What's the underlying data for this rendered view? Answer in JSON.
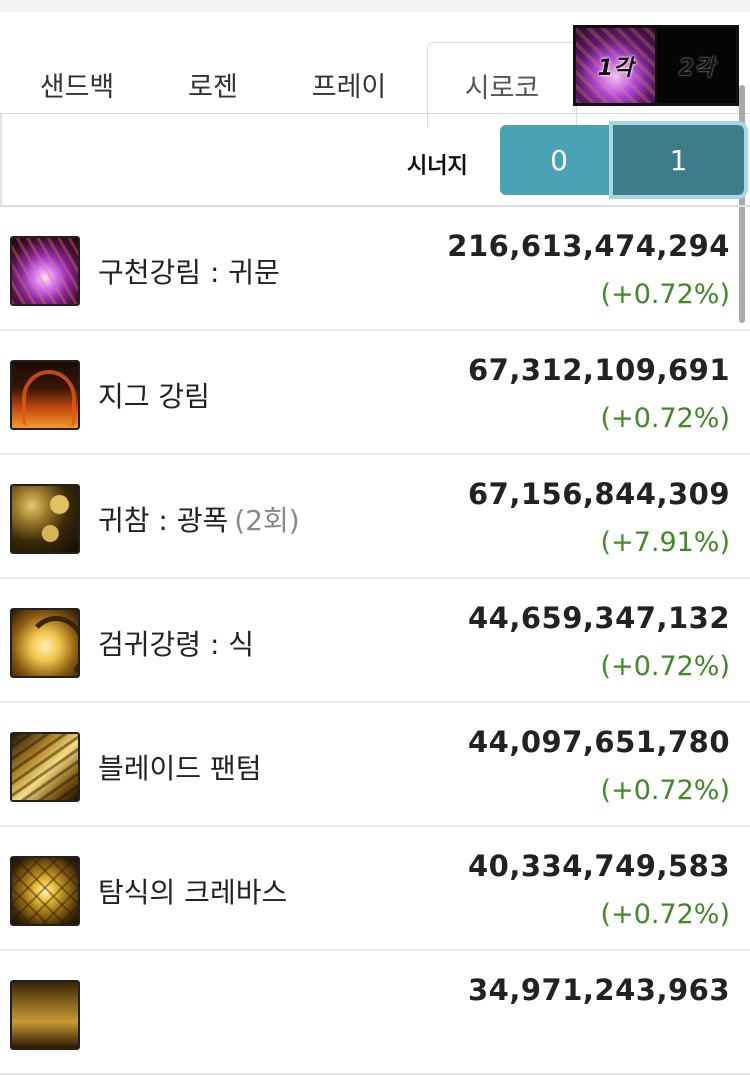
{
  "tabs": [
    {
      "label": "샌드백",
      "active": false
    },
    {
      "label": "로젠",
      "active": false
    },
    {
      "label": "프레이",
      "active": false
    },
    {
      "label": "시로코",
      "active": true
    }
  ],
  "awakening_toggle": {
    "first": "1각",
    "second": "2각",
    "selected": "1각"
  },
  "synergy": {
    "label": "시너지",
    "options": [
      "0",
      "1"
    ],
    "selected": "1"
  },
  "skills": [
    {
      "icon": "guicheon-ganglim-icon",
      "name": "구천강림 : 귀문",
      "count": "",
      "damage": "216,613,474,294",
      "change": "(+0.72%)"
    },
    {
      "icon": "jig-ganglim-icon",
      "name": "지그 강림",
      "count": "",
      "damage": "67,312,109,691",
      "change": "(+0.72%)"
    },
    {
      "icon": "gwicham-gwangpok-icon",
      "name": "귀참 : 광폭",
      "count": "(2회)",
      "damage": "67,156,844,309",
      "change": "(+7.91%)"
    },
    {
      "icon": "geomgwi-ganglyeong-icon",
      "name": "검귀강령 : 식",
      "count": "",
      "damage": "44,659,347,132",
      "change": "(+0.72%)"
    },
    {
      "icon": "blade-phantom-icon",
      "name": "블레이드 팬텀",
      "count": "",
      "damage": "44,097,651,780",
      "change": "(+0.72%)"
    },
    {
      "icon": "tamsik-krevas-icon",
      "name": "탐식의 크레바스",
      "count": "",
      "damage": "40,334,749,583",
      "change": "(+0.72%)"
    },
    {
      "icon": "partial-skill-icon",
      "name": "",
      "count": "",
      "damage": "34,971,243,963",
      "change": ""
    }
  ],
  "colors": {
    "synergy_inactive": "#4aa3b4",
    "synergy_active": "#3d7c88",
    "positive_change": "#3e8a25"
  }
}
